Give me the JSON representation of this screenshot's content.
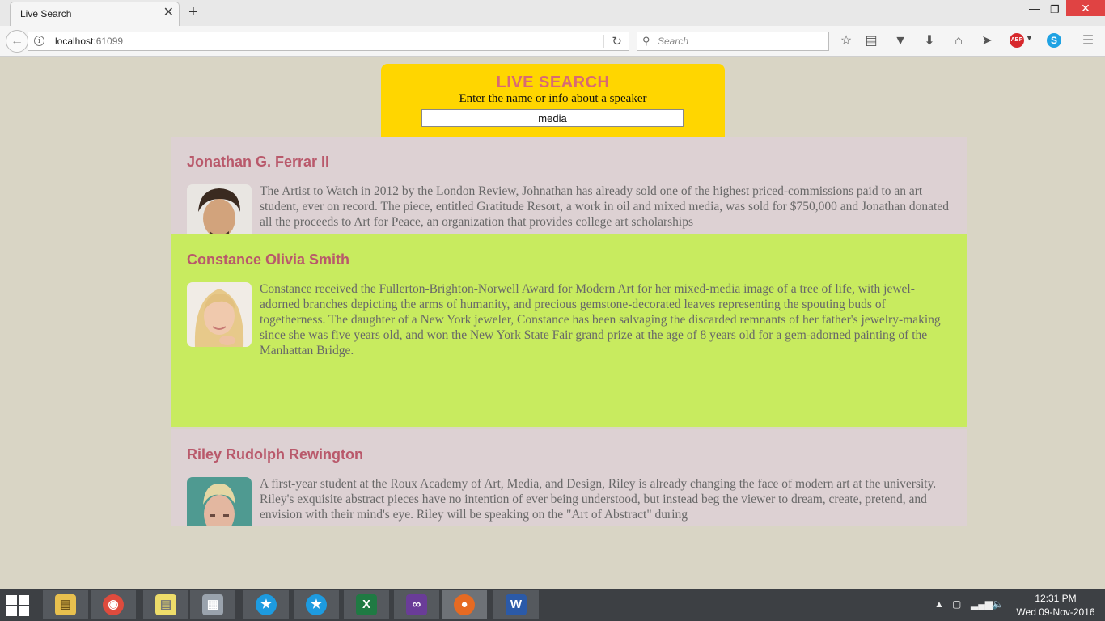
{
  "browser": {
    "tab_title": "Live Search",
    "tab_close": "✕",
    "new_tab": "+",
    "url_host": "localhost",
    "url_port": ":61099",
    "search_placeholder": "Search",
    "window_controls": {
      "minimize": "—",
      "maximize": "❐",
      "close": "✕"
    },
    "toolbar_icons": [
      "bookmark-star-icon",
      "reading-list-icon",
      "pocket-icon",
      "download-icon",
      "home-icon",
      "share-icon",
      "adblock-plus-icon",
      "skype-icon",
      "menu-icon"
    ],
    "abp_label": "ABP"
  },
  "search_panel": {
    "title": "LIVE SEARCH",
    "subtitle": "Enter the name or info about a speaker",
    "query": "media",
    "background": "#ffd600",
    "title_color": "#d86a73"
  },
  "results": [
    {
      "name": "Jonathan G. Ferrar II",
      "bio": "The Artist to Watch in 2012 by the London Review, Johnathan has already sold one of the highest priced-commissions paid to an art student, ever on record. The piece, entitled Gratitude Resort, a work in oil and mixed media, was sold for $750,000 and Jonathan donated all the proceeds to Art for Peace, an organization that provides college art scholarships"
    },
    {
      "name": "Constance Olivia Smith",
      "bio": "Constance received the Fullerton-Brighton-Norwell Award for Modern Art for her mixed-media image of a tree of life, with jewel-adorned branches depicting the arms of humanity, and precious gemstone-decorated leaves representing the spouting buds of togetherness. The daughter of a New York jeweler, Constance has been salvaging the discarded remnants of her father's jewelry-making since she was five years old, and won the New York State Fair grand prize at the age of 8 years old for a gem-adorned painting of the Manhattan Bridge."
    },
    {
      "name": "Riley Rudolph Rewington",
      "bio": "A first-year student at the Roux Academy of Art, Media, and Design, Riley is already changing the face of modern art at the university. Riley's exquisite abstract pieces have no intention of ever being understood, but instead beg the viewer to dream, create, pretend, and envision with their mind's eye. Riley will be speaking on the \"Art of Abstract\" during"
    }
  ],
  "colors": {
    "card_default": "#ddd1d3",
    "card_active": "#c8eb5f",
    "name_color": "#b9596b",
    "page_bg": "#d9d5c5"
  },
  "taskbar": {
    "apps": [
      "file-explorer-icon",
      "chrome-icon",
      "sticky-notes-icon",
      "app-icon",
      "teamviewer-icon",
      "teamviewer-icon",
      "excel-icon",
      "visual-studio-icon",
      "firefox-icon",
      "word-icon"
    ],
    "time": "12:31 PM",
    "date": "Wed 09-Nov-2016"
  }
}
